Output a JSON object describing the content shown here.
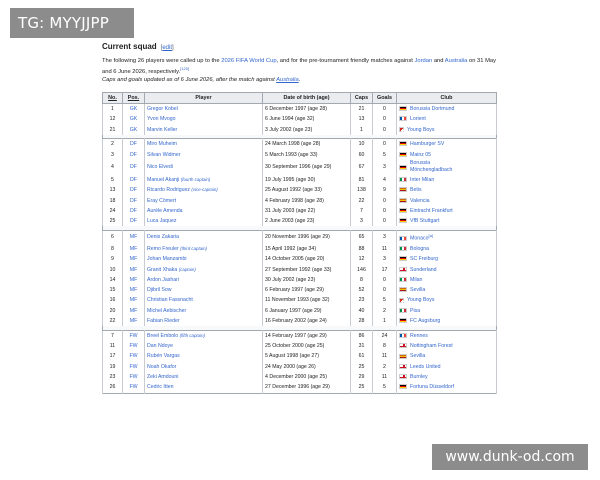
{
  "overlays": {
    "top_left": "TG: MYYJJPP",
    "bottom_right": "www.dunk-od.com"
  },
  "section": {
    "title": "Current squad",
    "edit_open": "[",
    "edit_label": "edit",
    "edit_close": "]",
    "intro_1": "The following 26 players were called up to the ",
    "intro_link_1": "2026 FIFA World Cup",
    "intro_2": ", and for the pre-tournament friendly matches against ",
    "intro_link_2": "Jordan",
    "intro_3": " and ",
    "intro_link_3": "Australia",
    "intro_4": " on 31 May and 6 June 2026, respectively.",
    "intro_ref": "[120]",
    "caps_note_1": "Caps and goals updated as of 6 June 2026, after the match against ",
    "caps_note_link": "Australia",
    "caps_note_2": "."
  },
  "table": {
    "headers": [
      "No.",
      "Pos.",
      "Player",
      "Date of birth (age)",
      "Caps",
      "Goals",
      "Club"
    ],
    "groups": [
      [
        {
          "no": "1",
          "pos": "GK",
          "player": "Gregor Kobel",
          "role": "",
          "dob": "6 December 1997 (age 28)",
          "caps": "21",
          "goals": "0",
          "club": "Borussia Dortmund",
          "flag": "germany"
        },
        {
          "no": "12",
          "pos": "GK",
          "player": "Yvon Mvogo",
          "role": "",
          "dob": "6 June 1994 (age 32)",
          "caps": "13",
          "goals": "0",
          "club": "Lorient",
          "flag": "france"
        },
        {
          "no": "21",
          "pos": "GK",
          "player": "Marvin Keller",
          "role": "",
          "dob": "3 July 2002 (age 23)",
          "caps": "1",
          "goals": "0",
          "club": "Young Boys",
          "flag": "switzerland"
        }
      ],
      [
        {
          "no": "2",
          "pos": "DF",
          "player": "Miro Muheim",
          "role": "",
          "dob": "24 March 1998 (age 28)",
          "caps": "10",
          "goals": "0",
          "club": "Hamburger SV",
          "flag": "germany"
        },
        {
          "no": "3",
          "pos": "DF",
          "player": "Silvan Widmer",
          "role": "",
          "dob": "5 March 1993 (age 33)",
          "caps": "60",
          "goals": "5",
          "club": "Mainz 05",
          "flag": "germany"
        },
        {
          "no": "4",
          "pos": "DF",
          "player": "Nico Elvedi",
          "role": "",
          "dob": "30 September 1996 (age 29)",
          "caps": "67",
          "goals": "3",
          "club": "Borussia Mönchengladbach",
          "flag": "germany",
          "tall": true
        },
        {
          "no": "5",
          "pos": "DF",
          "player": "Manuel Akanji",
          "role": "(fourth captain)",
          "dob": "19 July 1995 (age 30)",
          "caps": "81",
          "goals": "4",
          "club": "Inter Milan",
          "flag": "italy"
        },
        {
          "no": "13",
          "pos": "DF",
          "player": "Ricardo Rodriguez",
          "role": "(vice-captain)",
          "dob": "25 August 1992 (age 33)",
          "caps": "138",
          "goals": "9",
          "club": "Betis",
          "flag": "spain"
        },
        {
          "no": "18",
          "pos": "DF",
          "player": "Eray Cömert",
          "role": "",
          "dob": "4 February 1998 (age 28)",
          "caps": "22",
          "goals": "0",
          "club": "Valencia",
          "flag": "spain"
        },
        {
          "no": "24",
          "pos": "DF",
          "player": "Aurèle Amenda",
          "role": "",
          "dob": "31 July 2003 (age 22)",
          "caps": "7",
          "goals": "0",
          "club": "Eintracht Frankfurt",
          "flag": "germany"
        },
        {
          "no": "25",
          "pos": "DF",
          "player": "Luca Jaquez",
          "role": "",
          "dob": "2 June 2003 (age 23)",
          "caps": "3",
          "goals": "0",
          "club": "VfB Stuttgart",
          "flag": "germany"
        }
      ],
      [
        {
          "no": "6",
          "pos": "MF",
          "player": "Denis Zakaria",
          "role": "",
          "dob": "20 November 1996 (age 29)",
          "caps": "65",
          "goals": "3",
          "club": "Monaco",
          "club_ref": "[a]",
          "flag": "france"
        },
        {
          "no": "8",
          "pos": "MF",
          "player": "Remo Freuler",
          "role": "(third captain)",
          "dob": "15 April 1992 (age 34)",
          "caps": "88",
          "goals": "11",
          "club": "Bologna",
          "flag": "italy"
        },
        {
          "no": "9",
          "pos": "MF",
          "player": "Johan Manzambi",
          "role": "",
          "dob": "14 October 2005 (age 20)",
          "caps": "12",
          "goals": "3",
          "club": "SC Freiburg",
          "flag": "germany"
        },
        {
          "no": "10",
          "pos": "MF",
          "player": "Granit Xhaka",
          "role": "(captain)",
          "dob": "27 September 1992 (age 33)",
          "caps": "146",
          "goals": "17",
          "club": "Sunderland",
          "flag": "england"
        },
        {
          "no": "14",
          "pos": "MF",
          "player": "Ardon Jashari",
          "role": "",
          "dob": "30 July 2002 (age 23)",
          "caps": "8",
          "goals": "0",
          "club": "Milan",
          "flag": "italy"
        },
        {
          "no": "15",
          "pos": "MF",
          "player": "Djibril Sow",
          "role": "",
          "dob": "6 February 1997 (age 29)",
          "caps": "52",
          "goals": "0",
          "club": "Sevilla",
          "flag": "spain"
        },
        {
          "no": "16",
          "pos": "MF",
          "player": "Christian Fassnacht",
          "role": "",
          "dob": "11 November 1993 (age 32)",
          "caps": "23",
          "goals": "5",
          "club": "Young Boys",
          "flag": "switzerland"
        },
        {
          "no": "20",
          "pos": "MF",
          "player": "Michel Aebischer",
          "role": "",
          "dob": "6 January 1997 (age 29)",
          "caps": "40",
          "goals": "2",
          "club": "Pisa",
          "flag": "italy"
        },
        {
          "no": "22",
          "pos": "MF",
          "player": "Fabian Rieder",
          "role": "",
          "dob": "16 February 2002 (age 24)",
          "caps": "28",
          "goals": "1",
          "club": "FC Augsburg",
          "flag": "germany"
        }
      ],
      [
        {
          "no": "7",
          "pos": "FW",
          "player": "Breel Embolo",
          "role": "(fifth captain)",
          "dob": "14 February 1997 (age 29)",
          "caps": "86",
          "goals": "24",
          "club": "Rennes",
          "flag": "france"
        },
        {
          "no": "11",
          "pos": "FW",
          "player": "Dan Ndoye",
          "role": "",
          "dob": "25 October 2000 (age 25)",
          "caps": "31",
          "goals": "8",
          "club": "Nottingham Forest",
          "flag": "england"
        },
        {
          "no": "17",
          "pos": "FW",
          "player": "Rubén Vargas",
          "role": "",
          "dob": "5 August 1998 (age 27)",
          "caps": "61",
          "goals": "11",
          "club": "Sevilla",
          "flag": "spain"
        },
        {
          "no": "19",
          "pos": "FW",
          "player": "Noah Okafor",
          "role": "",
          "dob": "24 May 2000 (age 26)",
          "caps": "25",
          "goals": "2",
          "club": "Leeds United",
          "flag": "england"
        },
        {
          "no": "23",
          "pos": "FW",
          "player": "Zeki Amdouni",
          "role": "",
          "dob": "4 December 2000 (age 25)",
          "caps": "29",
          "goals": "11",
          "club": "Burnley",
          "flag": "england"
        },
        {
          "no": "26",
          "pos": "FW",
          "player": "Cedric Itten",
          "role": "",
          "dob": "27 December 1996 (age 29)",
          "caps": "25",
          "goals": "5",
          "club": "Fortuna Düsseldorf",
          "flag": "germany"
        }
      ]
    ]
  }
}
